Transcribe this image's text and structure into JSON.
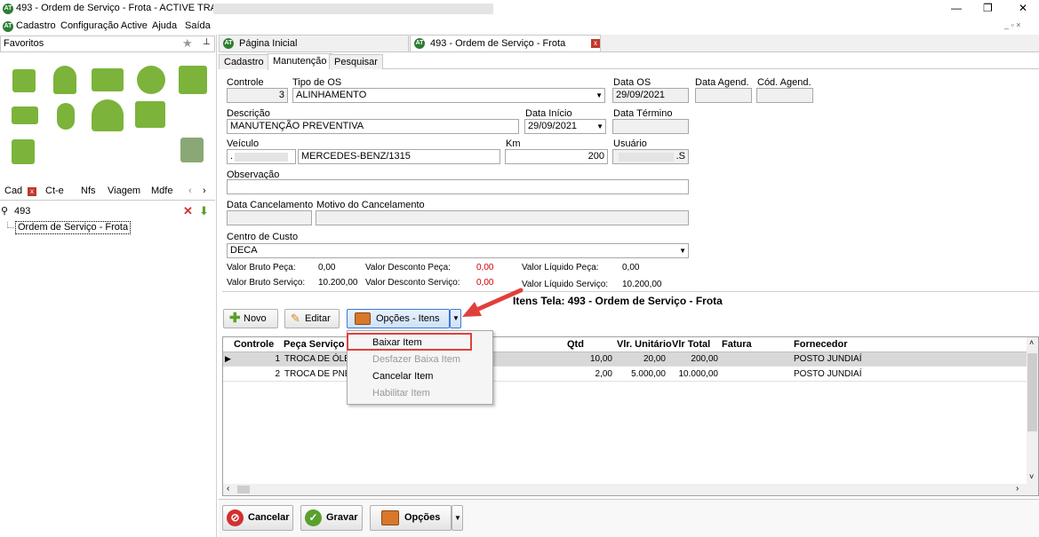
{
  "window": {
    "title": "493 - Ordem de Serviço - Frota - ACTIVE TRANS",
    "minimize": "—",
    "restore": "❐",
    "close": "✕"
  },
  "menu": [
    "Cadastro",
    "Configuração Active",
    "Ajuda",
    "Saída"
  ],
  "left_panel": {
    "favorites_label": "Favoritos",
    "tabs": [
      "Cad",
      "Ct-e",
      "Nfs",
      "Viagem",
      "Mdfe"
    ],
    "search_value": "493",
    "tree_item": "Ordem de Serviço - Frota"
  },
  "doc_tabs": [
    {
      "label": "Página Inicial"
    },
    {
      "label": "493 - Ordem de Serviço - Frota"
    }
  ],
  "sub_tabs": [
    "Cadastro",
    "Manutenção",
    "Pesquisar"
  ],
  "form": {
    "controle_label": "Controle",
    "controle_value": "3",
    "tipo_os_label": "Tipo de OS",
    "tipo_os_value": "ALINHAMENTO",
    "data_os_label": "Data OS",
    "data_os_value": "29/09/2021",
    "data_agend_label": "Data Agend.",
    "data_agend_value": "",
    "cod_agend_label": "Cód. Agend.",
    "cod_agend_value": "",
    "descricao_label": "Descrição",
    "descricao_value": "MANUTENÇÃO PREVENTIVA",
    "data_inicio_label": "Data Início",
    "data_inicio_value": "29/09/2021",
    "data_termino_label": "Data Término",
    "data_termino_value": "",
    "veiculo_label": "Veículo",
    "veiculo_prefix": ".",
    "veiculo_model": "MERCEDES-BENZ/1315",
    "km_label": "Km",
    "km_value": "200",
    "usuario_label": "Usuário",
    "usuario_suffix": ".S",
    "observacao_label": "Observação",
    "observacao_value": "",
    "data_cancel_label": "Data Cancelamento",
    "motivo_cancel_label": "Motivo do Cancelamento",
    "centro_custo_label": "Centro de Custo",
    "centro_custo_value": "DECA"
  },
  "totals": {
    "bruto_peca_label": "Valor Bruto Peça:",
    "bruto_peca_value": "0,00",
    "desc_peca_label": "Valor Desconto Peça:",
    "desc_peca_value": "0,00",
    "liq_peca_label": "Valor Líquido Peça:",
    "liq_peca_value": "0,00",
    "bruto_serv_label": "Valor Bruto Serviço:",
    "bruto_serv_value": "10.200,00",
    "desc_serv_label": "Valor Desconto Serviço:",
    "desc_serv_value": "0,00",
    "liq_serv_label": "Valor Líquido Serviço:",
    "liq_serv_value": "10.200,00"
  },
  "itens_title": "Itens Tela:  493 - Ordem de Serviço - Frota",
  "toolbar": {
    "novo": "Novo",
    "editar": "Editar",
    "opcoes_itens": "Opções - Itens"
  },
  "grid": {
    "headers": [
      "Controle",
      "Peça Serviço",
      "Qtd",
      "Vlr. Unitário",
      "Vlr Total",
      "Fatura",
      "Fornecedor"
    ],
    "rows": [
      {
        "controle": "1",
        "peca": "TROCA DE ÓLEO",
        "qtd": "10,00",
        "unit": "20,00",
        "total": "200,00",
        "fatura": "",
        "fornecedor": "POSTO JUNDIAÍ"
      },
      {
        "controle": "2",
        "peca": "TROCA DE PNEU",
        "qtd": "2,00",
        "unit": "5.000,00",
        "total": "10.000,00",
        "fatura": "",
        "fornecedor": "POSTO JUNDIAÍ"
      }
    ]
  },
  "dropdown_menu": [
    {
      "label": "Baixar Item",
      "enabled": true
    },
    {
      "label": "Desfazer Baixa Item",
      "enabled": false
    },
    {
      "label": "Cancelar Item",
      "enabled": true
    },
    {
      "label": "Habilitar Item",
      "enabled": false
    }
  ],
  "bottom": {
    "cancelar": "Cancelar",
    "gravar": "Gravar",
    "opcoes": "Opções"
  },
  "colors": {
    "accent_green": "#7cb33b",
    "highlight_red": "#e0403c",
    "value_red": "#d00000"
  }
}
